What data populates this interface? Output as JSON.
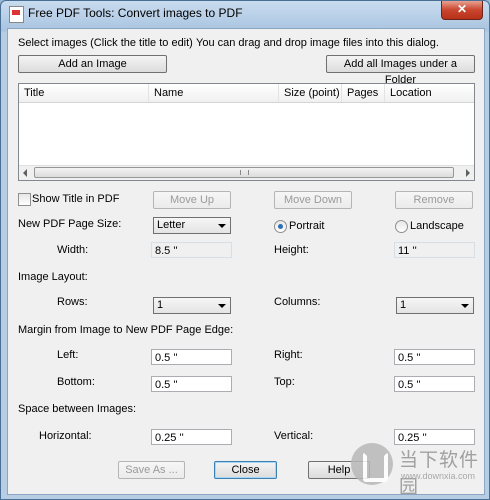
{
  "window": {
    "title": "Free PDF Tools: Convert images to PDF",
    "close_glyph": "✕"
  },
  "top": {
    "select_hint": "Select images (Click the title to edit)",
    "drag_hint": "You can drag and drop image files into this dialog.",
    "add_image": "Add an Image",
    "add_folder": "Add all Images under a Folder"
  },
  "table": {
    "columns": [
      "Title",
      "Name",
      "Size (point)",
      "Pages",
      "Location"
    ]
  },
  "options": {
    "show_title": "Show Title in PDF",
    "move_up": "Move Up",
    "move_down": "Move Down",
    "remove": "Remove",
    "page_size_label": "New PDF Page Size:",
    "page_size_value": "Letter",
    "portrait": "Portrait",
    "landscape": "Landscape",
    "width_label": "Width:",
    "width_value": "8.5 ''",
    "height_label": "Height:",
    "height_value": "11 ''",
    "layout_label": "Image Layout:",
    "rows_label": "Rows:",
    "rows_value": "1",
    "columns_label": "Columns:",
    "columns_value": "1",
    "margin_label": "Margin from Image to New PDF Page Edge:",
    "left_label": "Left:",
    "left_value": "0.5 ''",
    "right_label": "Right:",
    "right_value": "0.5 ''",
    "bottom_label": "Bottom:",
    "bottom_value": "0.5 ''",
    "top_label": "Top:",
    "top_value": "0.5 ''",
    "space_label": "Space between Images:",
    "horizontal_label": "Horizontal:",
    "horizontal_value": "0.25 ''",
    "vertical_label": "Vertical:",
    "vertical_value": "0.25 ''"
  },
  "footer": {
    "save_as": "Save As ...",
    "close": "Close",
    "help": "Help"
  },
  "watermark": {
    "cn": "当下软件园",
    "url": "www.downxia.com"
  }
}
